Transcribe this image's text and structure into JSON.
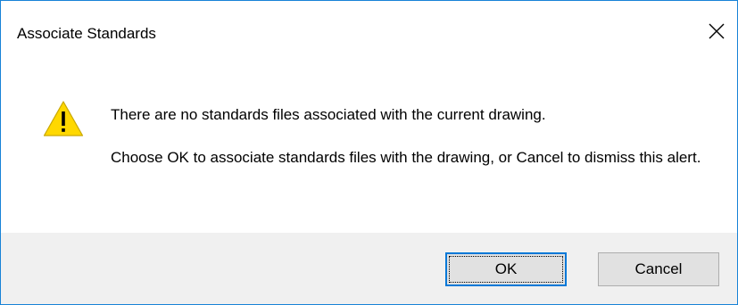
{
  "window": {
    "title": "Associate Standards",
    "close_icon": "close-icon",
    "accent_border_color": "#1883d7"
  },
  "message": {
    "icon": "warning-icon",
    "icon_color": "#ffd800",
    "line1": "There are no standards files associated with the current drawing.",
    "line2": "Choose OK to associate standards files with the drawing, or Cancel to dismiss this alert."
  },
  "buttons": {
    "ok_label": "OK",
    "cancel_label": "Cancel",
    "default_button_border": "#0078d7"
  }
}
